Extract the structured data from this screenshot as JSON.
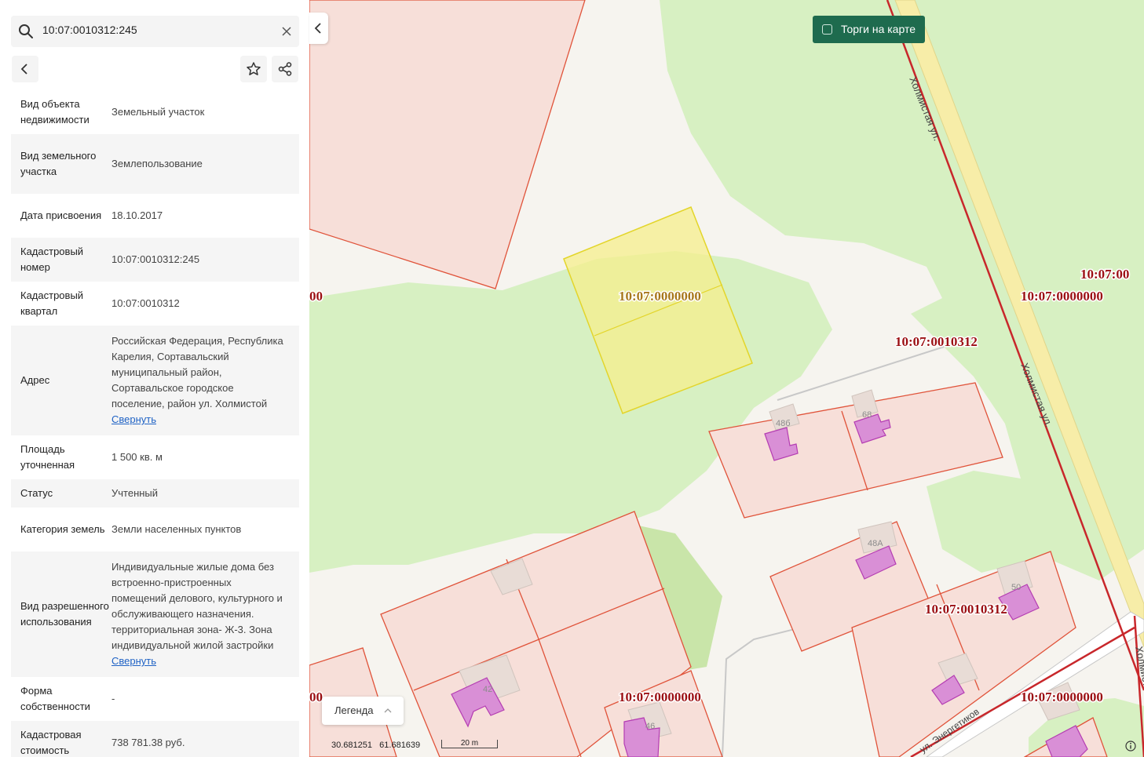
{
  "search": {
    "value": "10:07:0010312:245"
  },
  "details": [
    {
      "key": "Вид объекта недвижимости",
      "value": "Земельный участок"
    },
    {
      "key": "Вид земельного участка",
      "value": "Землепользование"
    },
    {
      "key": "Дата присвоения",
      "value": "18.10.2017"
    },
    {
      "key": "Кадастровый номер",
      "value": "10:07:0010312:245"
    },
    {
      "key": "Кадастровый квартал",
      "value": "10:07:0010312"
    },
    {
      "key": "Адрес",
      "value": "Российская Федерация, Республика Карелия, Сортавальский муниципальный район, Сортавальское городское поселение, район ул. Холмистой",
      "link": "Свернуть"
    },
    {
      "key": "Площадь уточненная",
      "value": "1 500 кв. м"
    },
    {
      "key": "Статус",
      "value": "Учтенный"
    },
    {
      "key": "Категория земель",
      "value": "Земли населенных пунктов"
    },
    {
      "key": "Вид разрешенного использования",
      "value": "Индивидуальные жилые дома без встроенно-пристроенных помещений делового, культурного и обслуживающего назначения. территориальная зона- Ж-3. Зона индивидуальной жилой застройки",
      "link": "Свернуть"
    },
    {
      "key": "Форма собственности",
      "value": "-"
    },
    {
      "key": "Кадастровая стоимость",
      "value": "738 781.38 руб."
    }
  ],
  "map": {
    "torgi_label": "Торги на карте",
    "legend_label": "Легенда",
    "coords": "30.681251   61.681639",
    "scale_label": "20 m",
    "streets": [
      "Холмистая ул.",
      "Холмистая ул.",
      "Холмистая ул.",
      "ул. Энергетиков"
    ],
    "cadastral_labels": [
      "10:07:0000000",
      "10:07:0000000",
      "10:07:00",
      "10:07:0010312",
      "10:07:0010312",
      "10:07:0000000",
      "10:07:0000000",
      "10:07:0000000",
      "00",
      "00"
    ],
    "house_numbers": [
      "48б",
      "68",
      "48А",
      "50",
      "42",
      "46"
    ],
    "colors": {
      "parcel_border": "#e0533a",
      "parcel_fill": "#f7dfd9",
      "selected_fill": "#f5ef8c",
      "building": "#d98fd6",
      "greenery": "#d7f0c2",
      "road": "#f7eda8",
      "label": "#9b0e12"
    }
  }
}
